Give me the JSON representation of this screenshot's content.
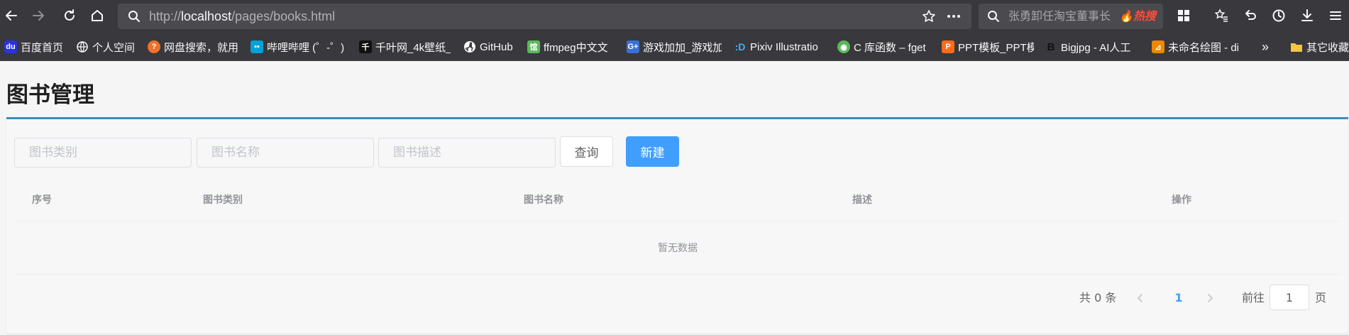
{
  "browser": {
    "url_scheme": "http://",
    "url_host": "localhost",
    "url_path": "/pages/books.html",
    "search_text": "张勇卸任淘宝董事长",
    "search_badge": "热搜",
    "bookmarks": [
      {
        "label": "百度首页",
        "icon": "baidu-icon",
        "color": "#2932e1"
      },
      {
        "label": "个人空间",
        "icon": "globe-icon",
        "color": "#38383d"
      },
      {
        "label": "网盘搜索，就用",
        "icon": "pansou-icon",
        "color": "#f0702c"
      },
      {
        "label": "哔哩哔哩 (゜-゜)",
        "icon": "bilibili-icon",
        "color": "#00a1d6"
      },
      {
        "label": "千叶网_4k壁纸_",
        "icon": "qianye-icon",
        "color": "#111111"
      },
      {
        "label": "GitHub",
        "icon": "github-icon",
        "color": "#38383d"
      },
      {
        "label": "ffmpeg中文文",
        "icon": "ffmpeg-icon",
        "color": "#5cb85c"
      },
      {
        "label": "游戏加加_游戏加",
        "icon": "youxijiajia-icon",
        "color": "#3a6fd8"
      },
      {
        "label": "Pixiv Illustratio",
        "icon": "pixiv-icon",
        "color": "#38383d"
      },
      {
        "label": "C 库函数 – fget",
        "icon": "runoob-icon",
        "color": "#5cb85c"
      },
      {
        "label": "PPT模板_PPT模",
        "icon": "ppt-icon",
        "color": "#ff6a1a"
      },
      {
        "label": "Bigjpg - AI人工",
        "icon": "bigjpg-icon",
        "color": "#38383d"
      },
      {
        "label": "未命名绘图 - di",
        "icon": "drawio-icon",
        "color": "#f08705"
      },
      {
        "label": "其它收藏",
        "icon": "folder-icon",
        "color": "#f6c443"
      }
    ],
    "more_glyph": "»"
  },
  "page": {
    "title": "图书管理"
  },
  "filters": {
    "category_placeholder": "图书类别",
    "name_placeholder": "图书名称",
    "desc_placeholder": "图书描述",
    "query_label": "查询",
    "create_label": "新建"
  },
  "table": {
    "columns": [
      "序号",
      "图书类别",
      "图书名称",
      "描述",
      "操作"
    ],
    "rows": [],
    "empty_text": "暂无数据"
  },
  "pagination": {
    "total_text": "共 0 条",
    "current_page": "1",
    "goto_label": "前往",
    "goto_value": "1",
    "page_suffix": "页"
  },
  "colors": {
    "primary": "#409eff",
    "card_accent": "#3c8dbc",
    "chrome": "#38383d"
  }
}
